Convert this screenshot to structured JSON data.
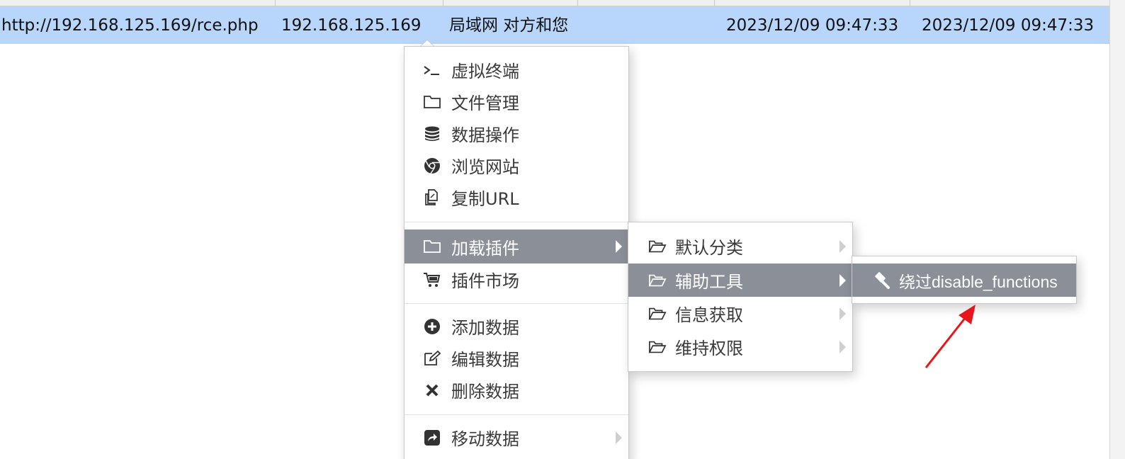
{
  "row": {
    "url": "http://192.168.125.169/rce.php",
    "ip": "192.168.125.169",
    "location": "局域网 对方和您",
    "created": "2023/12/09 09:47:33",
    "updated": "2023/12/09 09:47:33"
  },
  "context_menu": {
    "items": [
      {
        "label": "虚拟终端",
        "icon": "terminal-icon"
      },
      {
        "label": "文件管理",
        "icon": "folder-icon"
      },
      {
        "label": "数据操作",
        "icon": "database-icon"
      },
      {
        "label": "浏览网站",
        "icon": "chrome-icon"
      },
      {
        "label": "复制URL",
        "icon": "copy-icon"
      },
      {
        "label": "加载插件",
        "icon": "folder-icon"
      },
      {
        "label": "插件市场",
        "icon": "cart-icon"
      },
      {
        "label": "添加数据",
        "icon": "plus-circle-icon"
      },
      {
        "label": "编辑数据",
        "icon": "edit-icon"
      },
      {
        "label": "删除数据",
        "icon": "close-icon"
      },
      {
        "label": "移动数据",
        "icon": "share-icon"
      }
    ]
  },
  "plugin_menu": {
    "items": [
      {
        "label": "默认分类",
        "icon": "folder-open-icon"
      },
      {
        "label": "辅助工具",
        "icon": "folder-open-icon"
      },
      {
        "label": "信息获取",
        "icon": "folder-open-icon"
      },
      {
        "label": "维持权限",
        "icon": "folder-open-icon"
      }
    ]
  },
  "tools_menu": {
    "items": [
      {
        "label": "绕过disable_functions",
        "icon": "gavel-icon"
      }
    ]
  },
  "colors": {
    "row_selected": "#b8d6fb",
    "menu_active": "#8a8f98",
    "annotation_arrow": "#e8161b"
  }
}
